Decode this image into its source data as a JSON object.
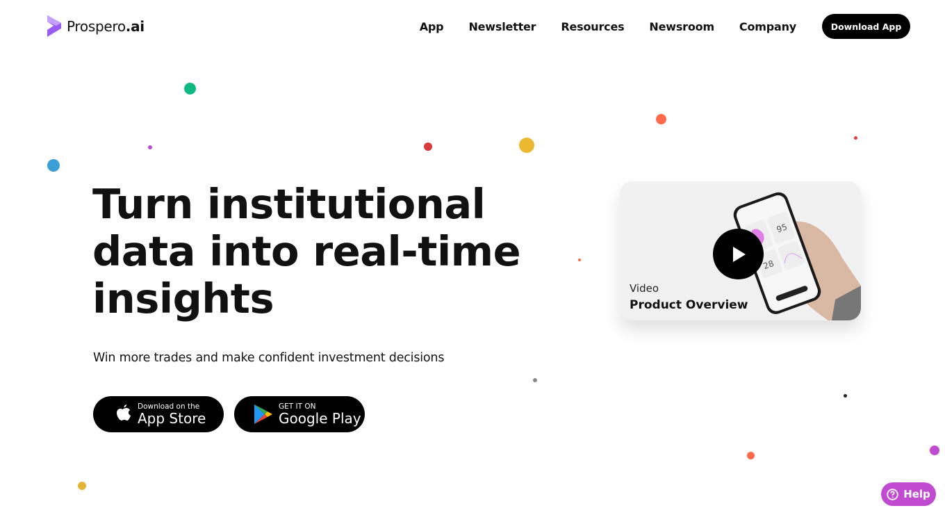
{
  "brand": {
    "name_regular": "Prospero",
    "name_bold": ".ai",
    "logo_color": "#9b5cf6"
  },
  "nav": {
    "items": [
      {
        "label": "App"
      },
      {
        "label": "Newsletter"
      },
      {
        "label": "Resources"
      },
      {
        "label": "Newsroom"
      },
      {
        "label": "Company"
      }
    ],
    "download_label": "Download App"
  },
  "hero": {
    "headline": "Turn institutional data into real-time insights",
    "subheadline": "Win more trades and make confident investment decisions"
  },
  "stores": {
    "apple": {
      "small": "Download on the",
      "big": "App Store",
      "icon": "apple-icon"
    },
    "google": {
      "small": "GET IT ON",
      "big": "Google Play",
      "icon": "google-play-icon"
    }
  },
  "video": {
    "label": "Video",
    "title": "Product Overview",
    "icon": "play-icon",
    "phone_stats": [
      "95",
      "28"
    ]
  },
  "help": {
    "label": "Help",
    "icon": "question-circle-icon",
    "color": "#c04ad0"
  },
  "decor_colors": [
    "#10b981",
    "#3b9fd6",
    "#c04ad0",
    "#d63a3a",
    "#eab831",
    "#ff6b4a",
    "#e04040",
    "#888888",
    "#222222",
    "#e5b53a"
  ]
}
